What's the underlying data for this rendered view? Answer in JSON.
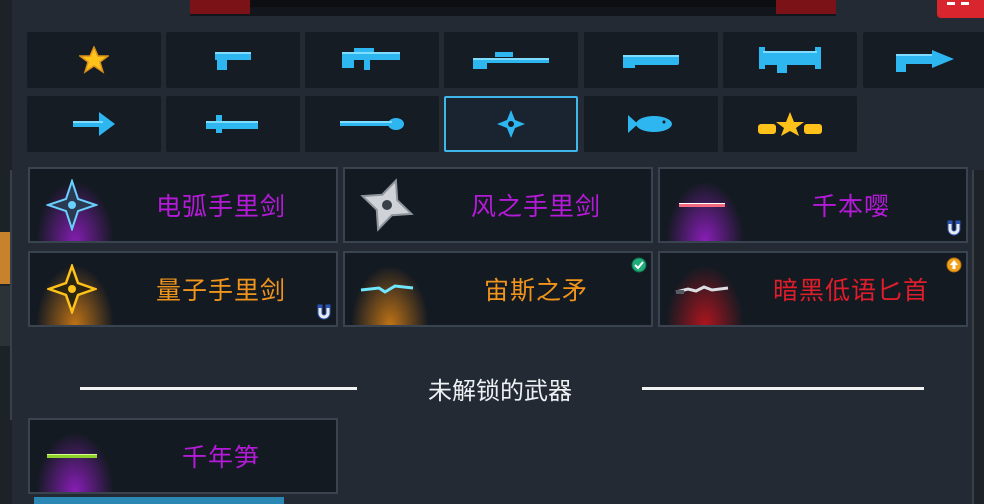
{
  "colors": {
    "selected_border": "#3fb7e8",
    "purple_text": "#b51ad9",
    "orange_text": "#f0941c",
    "red_text": "#e01d2a",
    "weapon_icon_blue": "#2db6f0",
    "star_gold": "#ffc21a"
  },
  "categories": [
    {
      "icon": "star-icon",
      "selected": false
    },
    {
      "icon": "pistol-icon",
      "selected": false
    },
    {
      "icon": "rifle-icon",
      "selected": false
    },
    {
      "icon": "sniper-icon",
      "selected": false
    },
    {
      "icon": "shotgun-icon",
      "selected": false
    },
    {
      "icon": "launcher-icon",
      "selected": false
    },
    {
      "icon": "laser-icon",
      "selected": false
    },
    {
      "icon": "bow-icon",
      "selected": false
    },
    {
      "icon": "sword-icon",
      "selected": false
    },
    {
      "icon": "spear-icon",
      "selected": false
    },
    {
      "icon": "shuriken-icon",
      "selected": true
    },
    {
      "icon": "fish-icon",
      "selected": false
    },
    {
      "icon": "crown-icon",
      "selected": false
    }
  ],
  "unlocked_weapons": [
    {
      "name": "电弧手里剑",
      "rarity_color": "purple",
      "icon": "arc-shuriken-icon",
      "badge": null
    },
    {
      "name": "风之手里剑",
      "rarity_color": "purple",
      "icon": "wind-shuriken-icon",
      "badge": null
    },
    {
      "name": "千本嘤",
      "rarity_color": "purple",
      "icon": "senbon-icon",
      "badge": "magnet-icon"
    },
    {
      "name": "量子手里剑",
      "rarity_color": "orange",
      "icon": "quantum-shuriken-icon",
      "badge": "magnet-icon"
    },
    {
      "name": "宙斯之矛",
      "rarity_color": "orange",
      "icon": "zeus-spear-icon",
      "badge": "check-icon"
    },
    {
      "name": "暗黑低语匕首",
      "rarity_color": "red",
      "icon": "dark-dagger-icon",
      "badge": "upgrade-icon"
    }
  ],
  "locked_section": {
    "title": "未解锁的武器"
  },
  "locked_weapons": [
    {
      "name": "千年笋",
      "rarity_color": "purple",
      "icon": "bamboo-needle-icon"
    }
  ]
}
